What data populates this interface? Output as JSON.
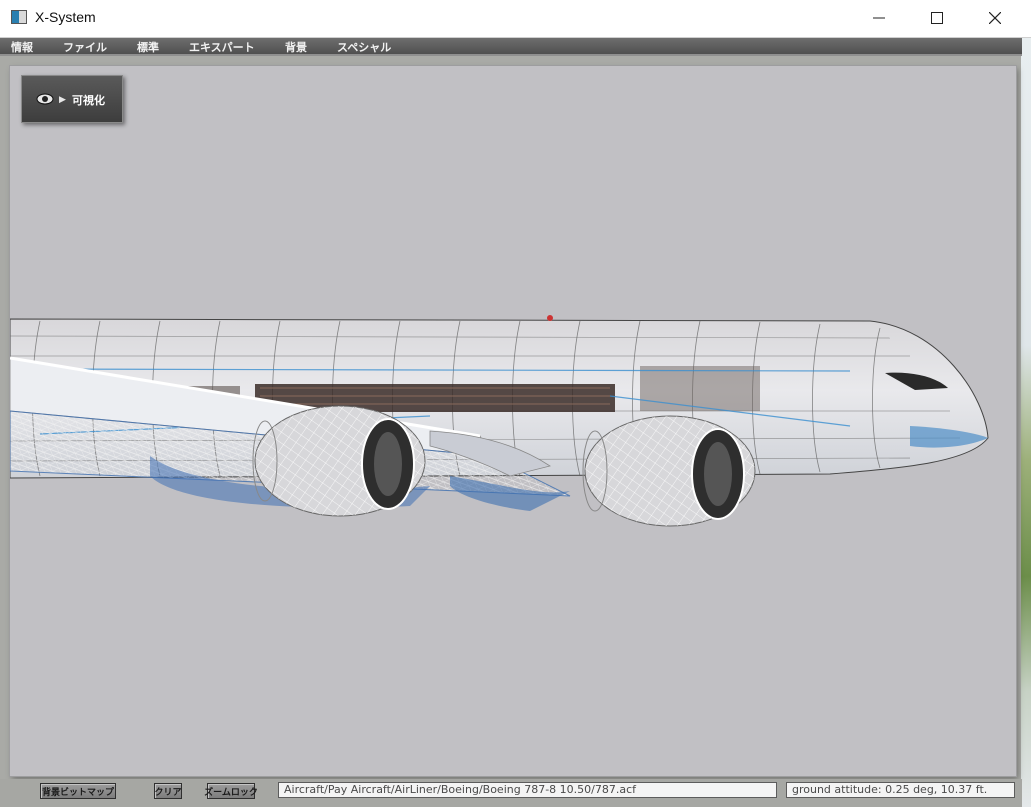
{
  "window": {
    "title": "X-System",
    "controls": [
      "minimize-icon",
      "maximize-icon",
      "close-icon"
    ]
  },
  "menu": {
    "items": [
      {
        "label": "情報"
      },
      {
        "label": "ファイル"
      },
      {
        "label": "標準"
      },
      {
        "label": "エキスパート"
      },
      {
        "label": "背景"
      },
      {
        "label": "スペシャル"
      }
    ]
  },
  "panel": {
    "label": "可視化",
    "icon": "eye-icon",
    "arrow": "▶"
  },
  "statusbar": {
    "bitmap_button": "背景ビットマップ",
    "clear_button": "クリア",
    "zoomlock_button": "ズームロック",
    "path": "Aircraft/Pay Aircraft/AirLiner/Boeing/Boeing 787-8 10.50/787.acf",
    "attitude": "ground attitude: 0.25 deg, 10.37 ft."
  },
  "colors": {
    "viewport_bg": "#c1c0c4",
    "menubar_bg": "#5a5a5a",
    "wireframe": "#ffffff",
    "wireframe_blue": "#2e5f9e"
  }
}
